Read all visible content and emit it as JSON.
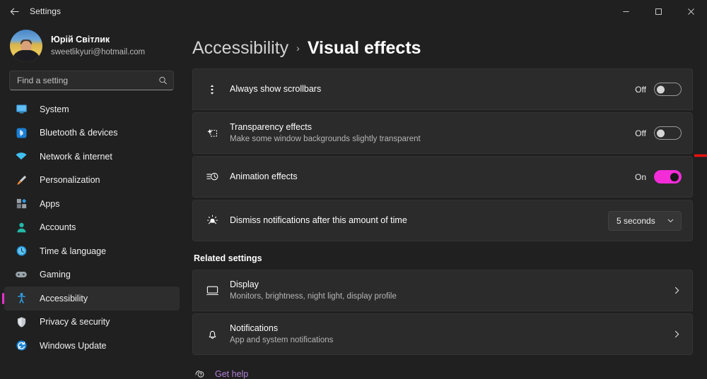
{
  "window": {
    "title": "Settings",
    "back_icon": "back-arrow-icon",
    "minimize_label": "—",
    "maximize_label": "□",
    "close_label": "✕"
  },
  "account": {
    "name": "Юрій Світлик",
    "email": "sweetlikyuri@hotmail.com",
    "avatar_icon": "user-avatar-photo"
  },
  "search": {
    "placeholder": "Find a setting",
    "value": "",
    "icon": "search-icon"
  },
  "sidebar": {
    "items": [
      {
        "label": "System",
        "icon": "system-icon",
        "selected": false
      },
      {
        "label": "Bluetooth & devices",
        "icon": "bluetooth-icon",
        "selected": false
      },
      {
        "label": "Network & internet",
        "icon": "wifi-icon",
        "selected": false
      },
      {
        "label": "Personalization",
        "icon": "paintbrush-icon",
        "selected": false
      },
      {
        "label": "Apps",
        "icon": "apps-icon",
        "selected": false
      },
      {
        "label": "Accounts",
        "icon": "person-icon",
        "selected": false
      },
      {
        "label": "Time & language",
        "icon": "clock-icon",
        "selected": false
      },
      {
        "label": "Gaming",
        "icon": "gamepad-icon",
        "selected": false
      },
      {
        "label": "Accessibility",
        "icon": "accessibility-icon",
        "selected": true
      },
      {
        "label": "Privacy & security",
        "icon": "shield-icon",
        "selected": false
      },
      {
        "label": "Windows Update",
        "icon": "update-icon",
        "selected": false
      }
    ]
  },
  "breadcrumb": {
    "parent": "Accessibility",
    "separator": "›",
    "current": "Visual effects"
  },
  "settings_rows": [
    {
      "id": "always-show-scrollbars",
      "title": "Always show scrollbars",
      "subtitle": "",
      "icon": "scrollbar-icon",
      "control": "toggle",
      "state_label": "Off",
      "state": "off"
    },
    {
      "id": "transparency-effects",
      "title": "Transparency effects",
      "subtitle": "Make some window backgrounds slightly transparent",
      "icon": "transparency-icon",
      "control": "toggle",
      "state_label": "Off",
      "state": "off"
    },
    {
      "id": "animation-effects",
      "title": "Animation effects",
      "subtitle": "",
      "icon": "animation-icon",
      "control": "toggle",
      "state_label": "On",
      "state": "on"
    },
    {
      "id": "dismiss-notifications",
      "title": "Dismiss notifications after this amount of time",
      "subtitle": "",
      "icon": "notification-bell-alert-icon",
      "control": "dropdown",
      "state_label": "5 seconds",
      "state": "dropdown"
    }
  ],
  "related": {
    "heading": "Related settings",
    "items": [
      {
        "title": "Display",
        "subtitle": "Monitors, brightness, night light, display profile",
        "icon": "monitor-icon",
        "chevron": "chevron-right-icon"
      },
      {
        "title": "Notifications",
        "subtitle": "App and system notifications",
        "icon": "bell-icon",
        "chevron": "chevron-right-icon"
      }
    ]
  },
  "get_help": {
    "label": "Get help",
    "icon": "help-question-icon"
  },
  "annotation": {
    "type": "red-arrow",
    "color": "#f01010",
    "points_to": "transparency-effects-toggle"
  },
  "colors": {
    "accent": "#e832c8",
    "toggle_on": "#f32cd8",
    "window_bg": "#202020",
    "card_bg": "#2b2b2b",
    "link": "#b07fd6",
    "annotation_red": "#f01010"
  }
}
